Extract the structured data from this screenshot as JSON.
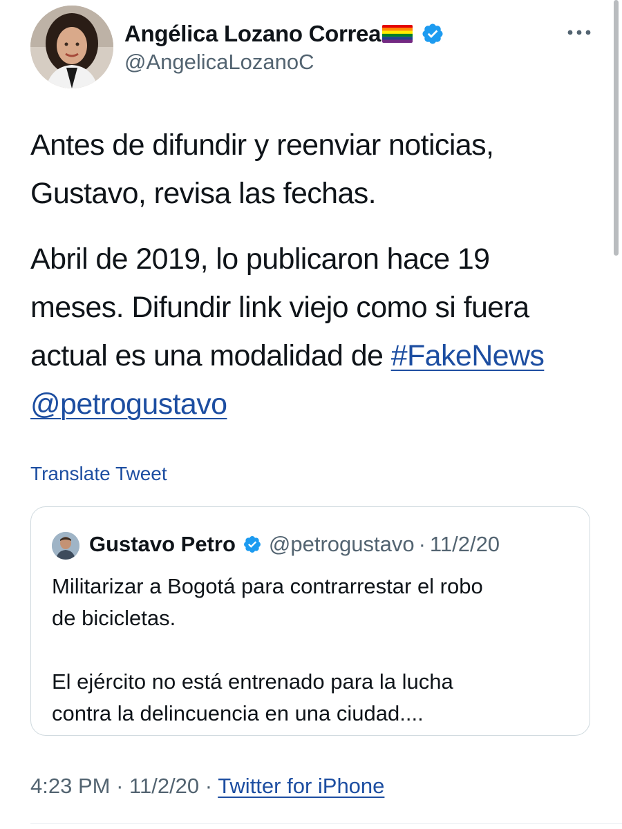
{
  "author": {
    "display_name": "Angélica Lozano Correa",
    "handle": "@AngelicaLozanoC"
  },
  "tweet": {
    "paragraph1": [
      "Antes de difundir y reenviar noticias,",
      "Gustavo, revisa las fechas."
    ],
    "paragraph2": {
      "line1": "Abril de 2019, lo publicaron hace 19",
      "line2": "meses. Difundir link viejo como si fuera",
      "line3_prefix": "actual es una modalidad de ",
      "hashtag": "#FakeNews",
      "mention": "@petrogustavo"
    },
    "translate_label": "Translate Tweet"
  },
  "quoted_tweet": {
    "display_name": "Gustavo Petro",
    "handle": "@petrogustavo",
    "separator": "·",
    "date": "11/2/20",
    "text_lines_a": [
      "Militarizar a Bogotá para contrarrestar el robo",
      "de bicicletas."
    ],
    "text_lines_b": [
      "El ejército no está entrenado para la lucha",
      "contra la delincuencia en una ciudad...."
    ]
  },
  "meta": {
    "time": "4:23 PM",
    "separator": "·",
    "date": "11/2/20",
    "source": "Twitter for iPhone"
  },
  "icons": {
    "verified": "verified-badge-icon",
    "flag": "rainbow-flag-icon",
    "more": "more-icon"
  },
  "colors": {
    "link": "#1d4ea1",
    "verified": "#1d9bf0",
    "secondary_text": "#536471"
  }
}
